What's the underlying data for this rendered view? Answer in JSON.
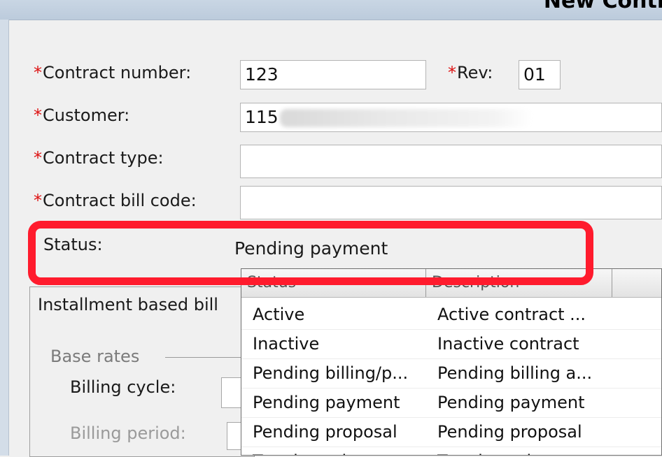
{
  "window": {
    "title": "New Contract"
  },
  "form": {
    "required_marker": "*",
    "contract_number_label": "Contract number:",
    "contract_number_value": "123",
    "rev_label": "Rev:",
    "rev_value": "01",
    "customer_label": "Customer:",
    "customer_value": "115",
    "contract_type_label": "Contract type:",
    "contract_type_value": "",
    "contract_bill_code_label": "Contract bill code:",
    "contract_bill_code_value": "",
    "status_label": "Status:",
    "status_value": "Pending payment"
  },
  "billing": {
    "group_label": "Installment based bill",
    "base_rates_label": "Base rates",
    "billing_cycle_label": "Billing cycle:",
    "billing_period_label": "Billing period:"
  },
  "status_dropdown": {
    "columns": [
      "Status",
      "Description"
    ],
    "rows": [
      {
        "status": "Active",
        "description": "Active contract ..."
      },
      {
        "status": "Inactive",
        "description": "Inactive contract"
      },
      {
        "status": "Pending billing/p...",
        "description": "Pending billing a..."
      },
      {
        "status": "Pending payment",
        "description": "Pending payment"
      },
      {
        "status": "Pending proposal",
        "description": "Pending proposal"
      },
      {
        "status": "Terminated",
        "description": "Terminated con..."
      }
    ]
  },
  "colors": {
    "highlight": "#ff1b2d",
    "required": "#dd1111"
  }
}
